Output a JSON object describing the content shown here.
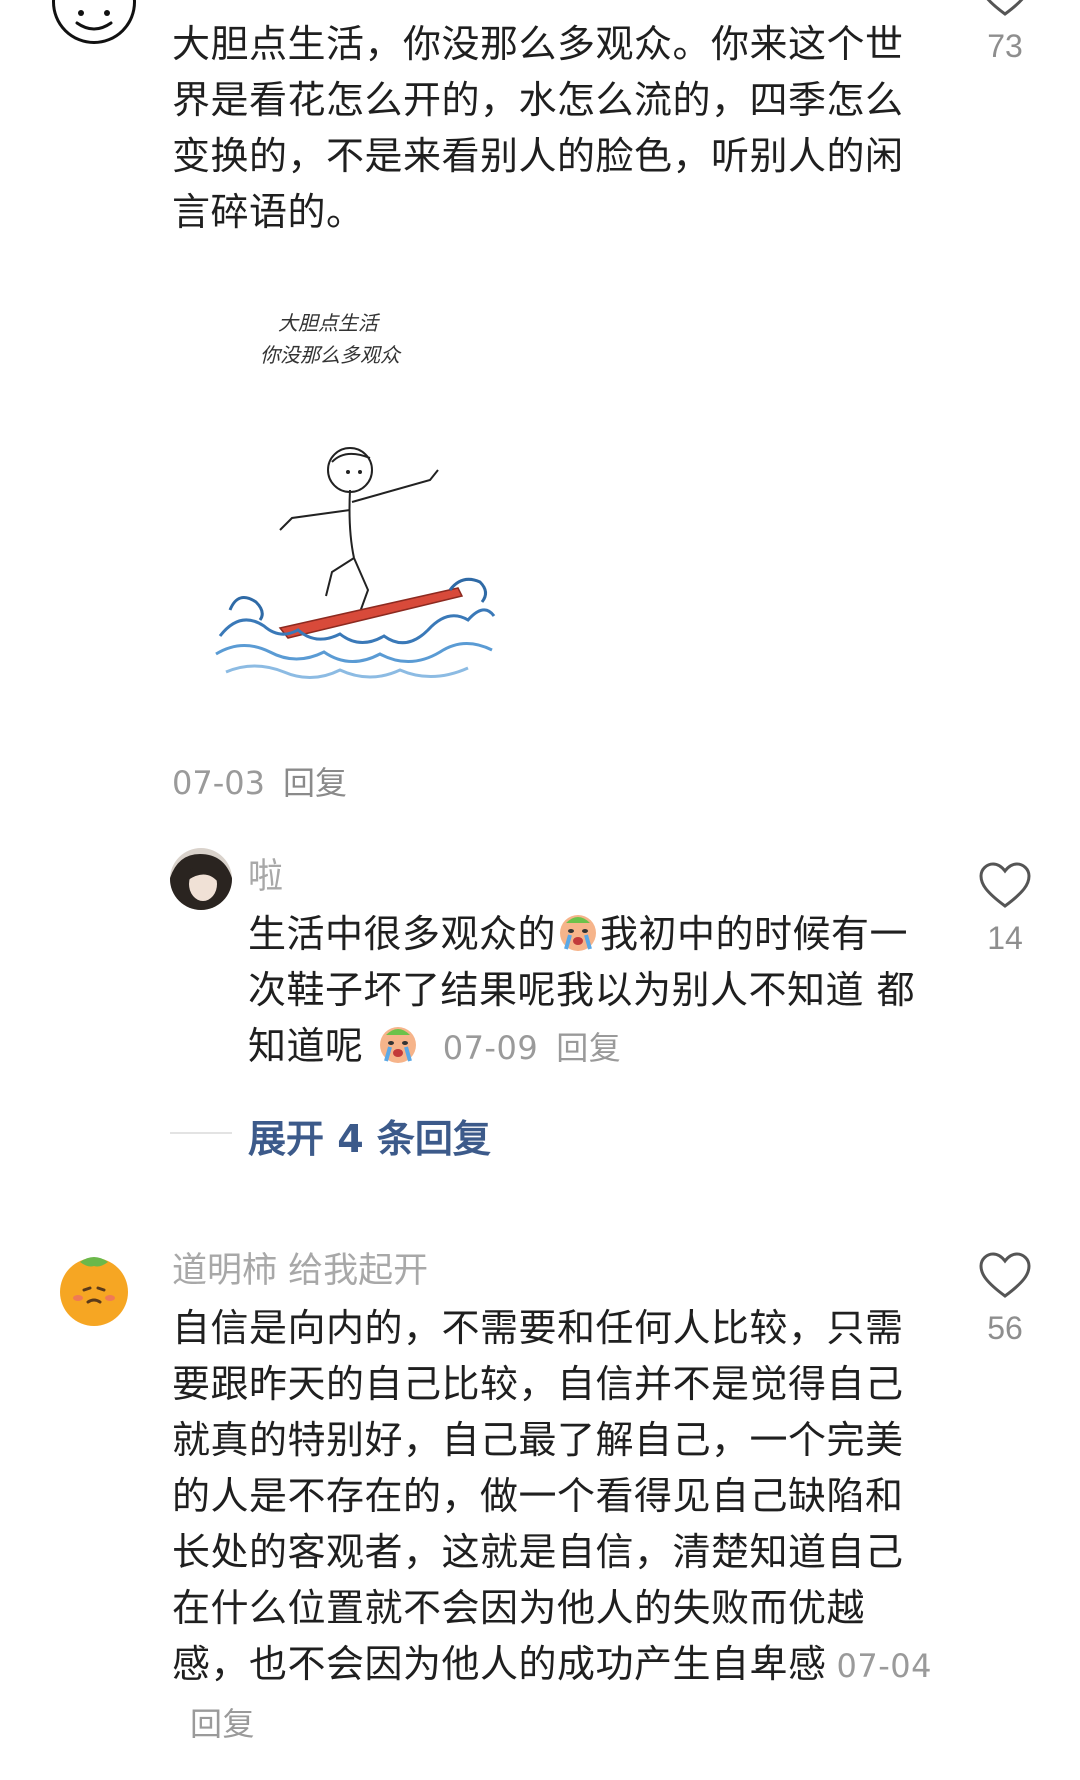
{
  "comment1": {
    "text": "大胆点生活，你没那么多观众。你来这个世界是看花怎么开的，水怎么流的，四季怎么变换的，不是来看别人的脸色，听别人的闲言碎语的。",
    "image_caption_line1": "大胆点生活",
    "image_caption_line2": "你没那么多观众",
    "like_count": "73",
    "date": "07-03",
    "reply_label": "回复"
  },
  "reply": {
    "nickname": "啦",
    "text_part1": "生活中很多观众的",
    "text_part2": "我初中的时候有一次鞋子坏了结果呢我以为别人不知道 都知道呢",
    "like_count": "14",
    "date": "07-09",
    "reply_label": "回复"
  },
  "expand": {
    "label": "展开 4 条回复"
  },
  "comment2": {
    "nickname": "道明柿 给我起开",
    "text": "自信是向内的，不需要和任何人比较，只需要跟昨天的自己比较，自信并不是觉得自己就真的特别好，自己最了解自己，一个完美的人是不存在的，做一个看得见自己缺陷和长处的客观者，这就是自信，清楚知道自己在什么位置就不会因为他人的失败而优越感，也不会因为他人的成功产生自卑感",
    "like_count": "56",
    "date": "07-04",
    "reply_label": "回复"
  },
  "colors": {
    "text": "#1f1f1f",
    "meta": "#9a9a9a",
    "link": "#3c5a8a",
    "avatar_orange": "#f6a623"
  },
  "icons": {
    "like": "heart-outline-icon",
    "crying_emoji": "crying-face-emoji"
  }
}
